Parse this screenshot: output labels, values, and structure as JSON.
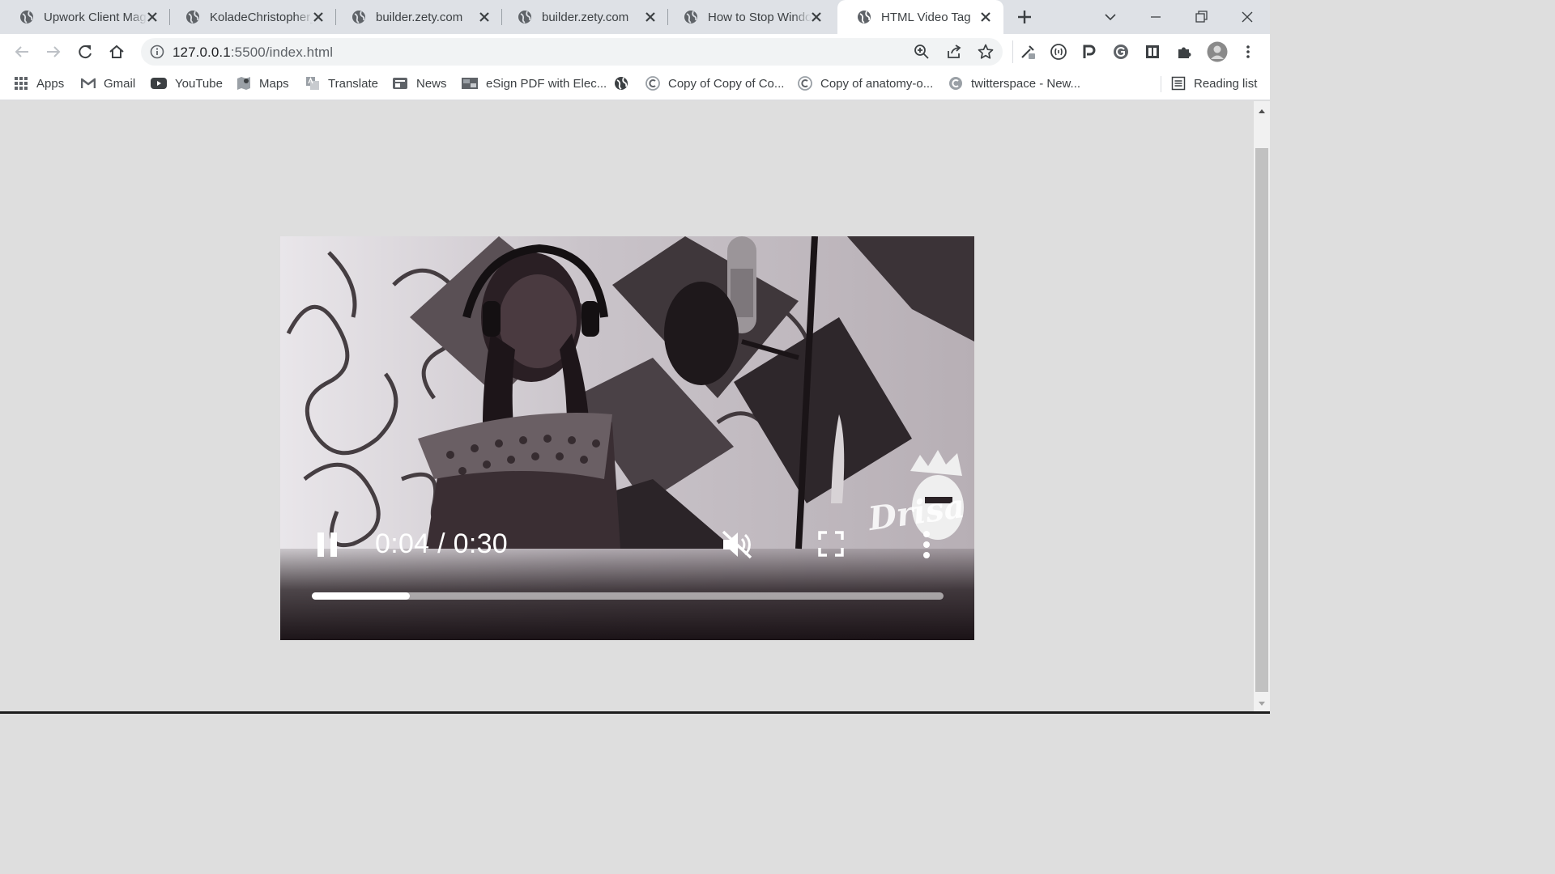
{
  "colors": {
    "tabstrip_bg": "#dee1e6",
    "active_tab_bg": "#ffffff",
    "page_bg": "#dedede",
    "video_controls": "#ffffff"
  },
  "tabs": [
    {
      "title": "Upwork Client Mag",
      "icon": "globe-icon",
      "active": false
    },
    {
      "title": "KoladeChristopher_",
      "icon": "globe-icon",
      "active": false
    },
    {
      "title": "builder.zety.com",
      "icon": "globe-icon",
      "active": false
    },
    {
      "title": "builder.zety.com",
      "icon": "globe-icon",
      "active": false
    },
    {
      "title": "How to Stop Windo",
      "icon": "globe-icon",
      "active": false
    },
    {
      "title": "HTML Video Tag",
      "icon": "globe-icon",
      "active": true
    }
  ],
  "omnibox": {
    "host": "127.0.0.1",
    "path": ":5500/index.html"
  },
  "bookmarks": [
    {
      "label": "Apps",
      "icon": "apps-grid-icon"
    },
    {
      "label": "Gmail",
      "icon": "gmail-icon"
    },
    {
      "label": "YouTube",
      "icon": "youtube-icon"
    },
    {
      "label": "Maps",
      "icon": "maps-icon"
    },
    {
      "label": "Translate",
      "icon": "translate-icon"
    },
    {
      "label": "News",
      "icon": "news-icon"
    },
    {
      "label": "eSign PDF with Elec...",
      "icon": "esign-icon"
    },
    {
      "label": "",
      "icon": "globe-icon"
    },
    {
      "label": "Copy of Copy of Co...",
      "icon": "c-circle-icon"
    },
    {
      "label": "Copy of anatomy-o...",
      "icon": "c-circle-icon"
    },
    {
      "label": "twitterspace - New...",
      "icon": "c-circle-icon"
    },
    {
      "label": "Reading list",
      "icon": "reading-list-icon"
    }
  ],
  "video": {
    "current_time": "0:04",
    "duration": "0:30",
    "time_display": "0:04 / 0:30",
    "progress_fraction": 0.155,
    "state": "playing",
    "muted": true,
    "watermark_text": "Drisa"
  }
}
